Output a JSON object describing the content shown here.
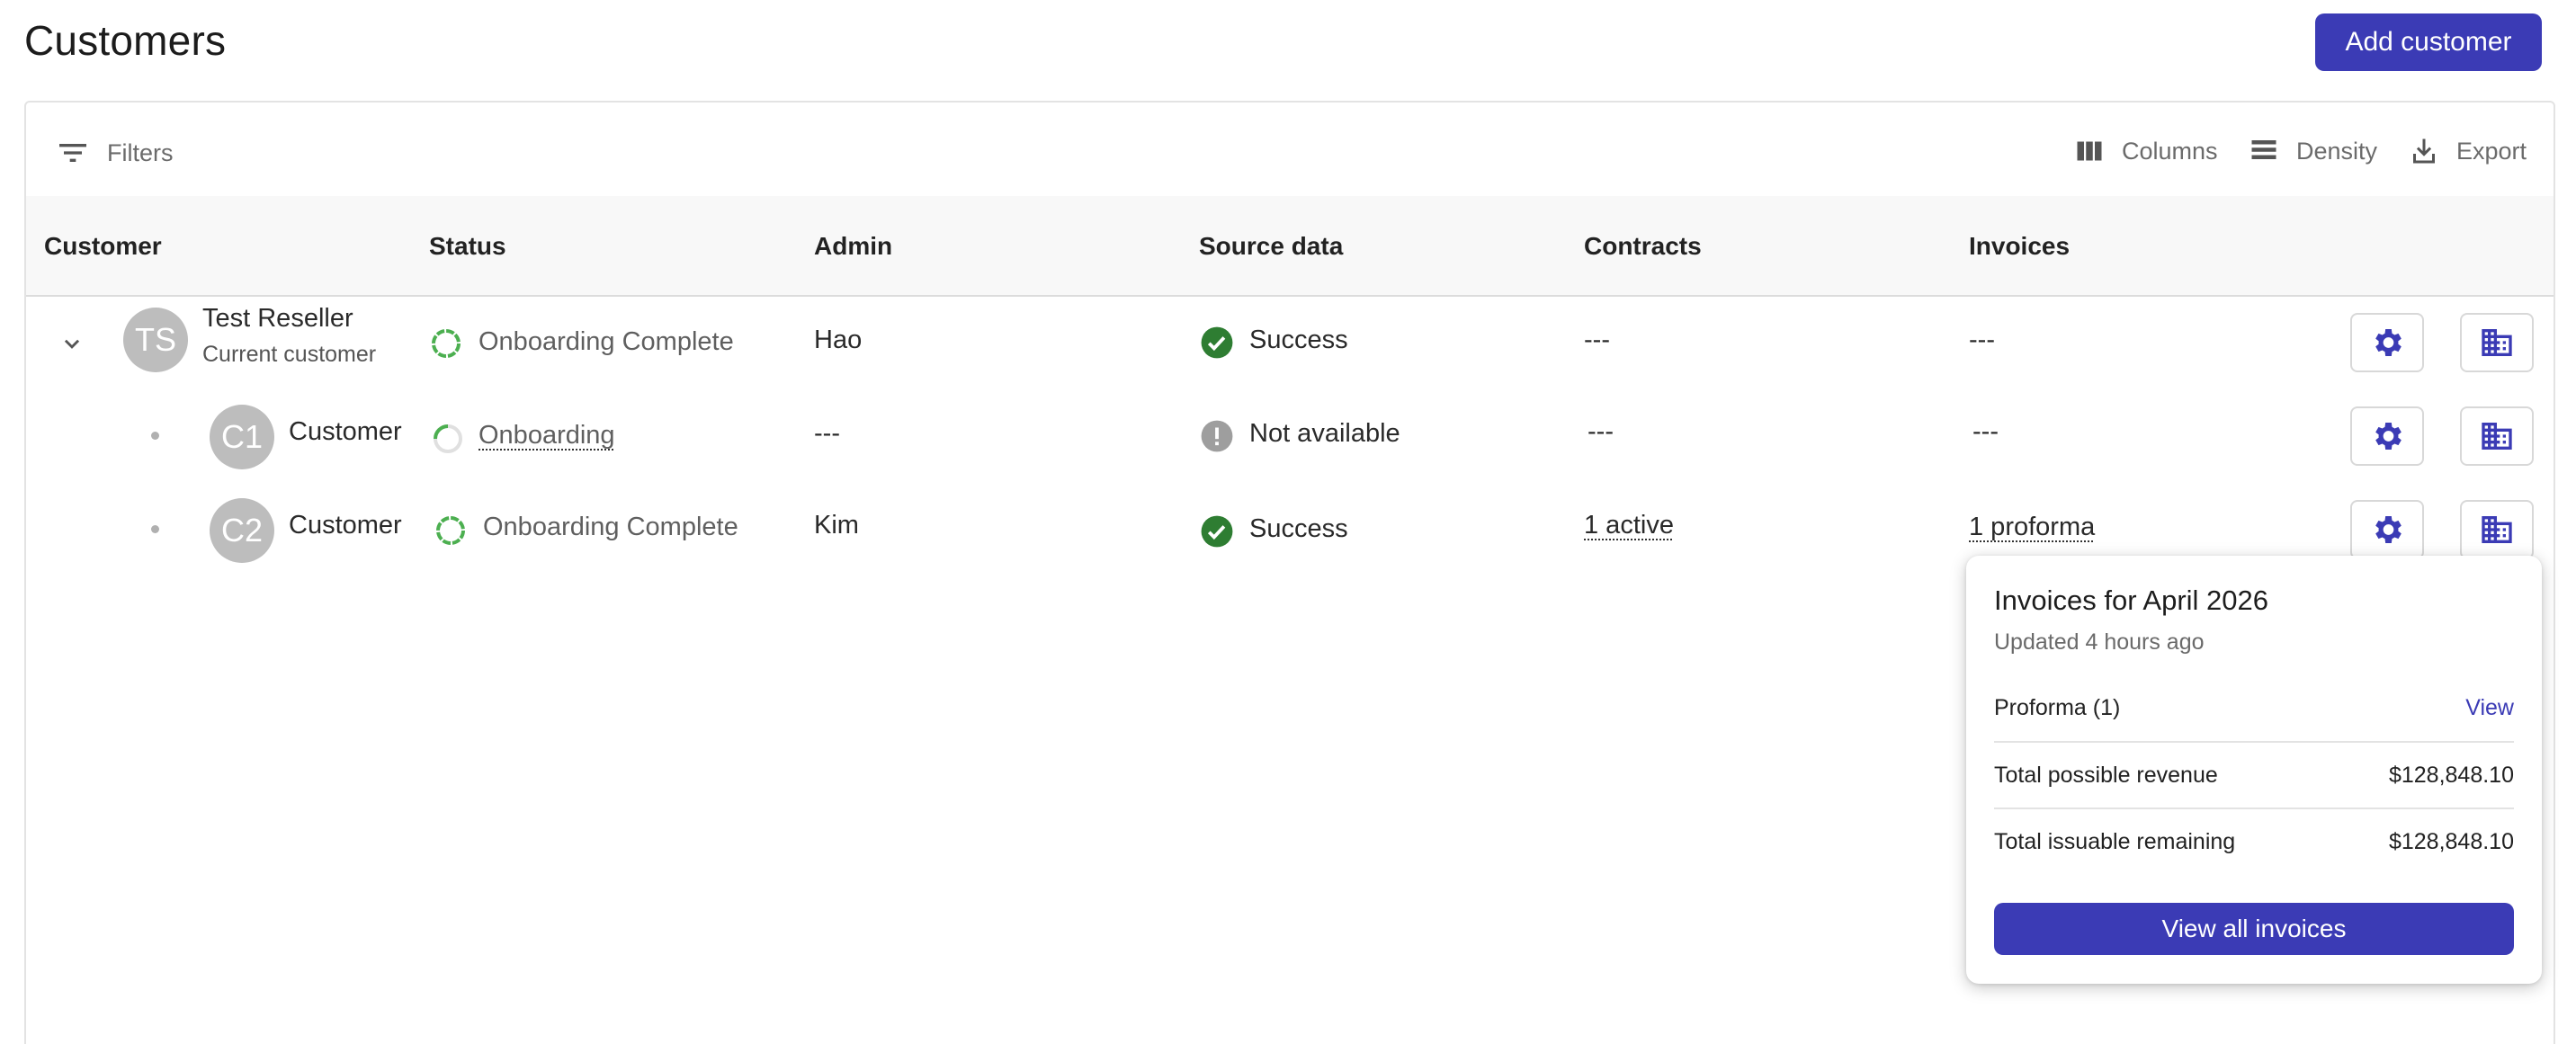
{
  "page": {
    "title": "Customers",
    "add_button": "Add customer"
  },
  "toolbar": {
    "filters": "Filters",
    "columns": "Columns",
    "density": "Density",
    "export": "Export"
  },
  "table": {
    "headers": [
      "Customer",
      "Status",
      "Admin",
      "Source data",
      "Contracts",
      "Invoices"
    ],
    "rows": [
      {
        "initials": "TS",
        "name": "Test Reseller",
        "subtitle": "Current customer",
        "status": "Onboarding Complete",
        "admin": "Hao",
        "source": "Success",
        "contracts": "---",
        "invoices": "---"
      },
      {
        "initials": "C1",
        "name": "Customer",
        "status": "Onboarding",
        "admin": "---",
        "source": "Not available",
        "contracts": "---",
        "invoices": "---"
      },
      {
        "initials": "C2",
        "name": "Customer",
        "status": "Onboarding Complete",
        "admin": "Kim",
        "source": "Success",
        "contracts": "1 active",
        "invoices": "1 proforma"
      }
    ]
  },
  "popover": {
    "title": "Invoices for April 2026",
    "updated": "Updated 4 hours ago",
    "proforma_label": "Proforma (1)",
    "proforma_link": "View",
    "revenue_label": "Total possible revenue",
    "revenue_value": "$128,848.10",
    "issuable_label": "Total issuable remaining",
    "issuable_value": "$128,848.10",
    "button": "View all invoices"
  },
  "colors": {
    "accent": "#3b3bb5",
    "success": "#2e7d32",
    "progress": "#4caf50",
    "neutral_icon": "#9e9e9e"
  },
  "icons": [
    "filter-icon",
    "columns-icon",
    "density-icon",
    "export-icon",
    "chevron-down-icon",
    "check-circle-icon",
    "info-circle-icon",
    "progress-ring-icon",
    "gear-icon",
    "building-icon"
  ]
}
